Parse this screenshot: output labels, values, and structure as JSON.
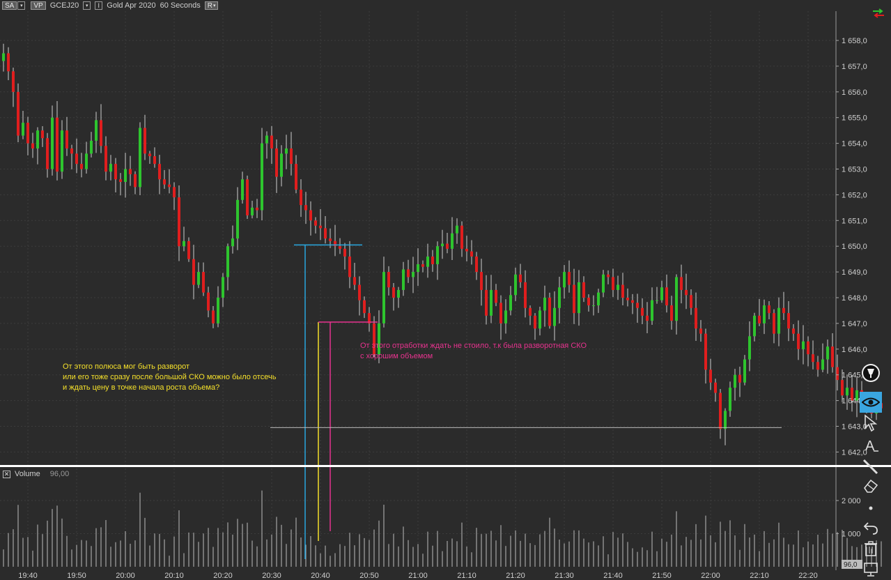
{
  "toolbar": {
    "sa_label": "SA",
    "vp_label": "VP",
    "symbol": "GCEJ20",
    "instrument": "Gold Apr 2020",
    "timeframe": "60 Seconds",
    "r_label": "R",
    "i_label": "I"
  },
  "price_axis": {
    "labels": [
      "1 658,0",
      "1 657,0",
      "1 656,0",
      "1 655,0",
      "1 654,0",
      "1 653,0",
      "1 652,0",
      "1 651,0",
      "1 650,0",
      "1 649,0",
      "1 648,0",
      "1 647,0",
      "1 646,0",
      "1 645,0",
      "1 644,0",
      "1 643,0",
      "1 642,0"
    ],
    "values": [
      1658,
      1657,
      1656,
      1655,
      1654,
      1653,
      1652,
      1651,
      1650,
      1649,
      1648,
      1647,
      1646,
      1645,
      1644,
      1643,
      1642
    ]
  },
  "time_axis": {
    "labels": [
      "19:40",
      "19:50",
      "20:00",
      "20:10",
      "20:20",
      "20:30",
      "20:40",
      "20:50",
      "21:00",
      "21:10",
      "21:20",
      "21:30",
      "21:40",
      "21:50",
      "22:00",
      "22:10",
      "22:20"
    ]
  },
  "volume_pane": {
    "title": "Volume",
    "value": "96,00",
    "axis_labels": [
      "2 000",
      "1 000"
    ],
    "axis_values": [
      2000,
      1000
    ],
    "last_value_badge": "96,0"
  },
  "annotations": {
    "yellow": [
      "От этого полюса мог быть разворот",
      "или его тоже сразу после большой СКО можно было отсечь",
      "и ждать цену в точке начала роста объема?"
    ],
    "pink": [
      "От этого отработки ждать не стоило, т.к была разворотная СКО",
      "с хорошим объемом"
    ]
  },
  "colors": {
    "background": "#2b2b2b",
    "up_candle": "#2ec52e",
    "down_candle": "#e01e1e",
    "wick": "#cfcfcf",
    "grid": "#3c3c3c",
    "annotation_blue": "#29a8e0",
    "annotation_yellow": "#f5e02a",
    "annotation_pink": "#e8338f",
    "separator": "#ffffff"
  },
  "drawing_tools": [
    {
      "name": "pen-tool-icon"
    },
    {
      "name": "eye-icon"
    },
    {
      "name": "pointer-arrow-icon"
    },
    {
      "name": "text-tool-icon",
      "glyph": "A"
    },
    {
      "name": "line-tool-icon"
    },
    {
      "name": "eraser-icon"
    },
    {
      "name": "dot-icon"
    },
    {
      "name": "undo-icon"
    },
    {
      "name": "trash-icon"
    },
    {
      "name": "monitor-icon"
    }
  ],
  "chart_data": {
    "type": "candlestick",
    "xlabel": "",
    "ylabel": "",
    "ylim": [
      1642,
      1658.5
    ],
    "volume_ylim": [
      0,
      2500
    ],
    "bar_interval_seconds": 60,
    "start_time": "19:35",
    "start_price": 1657.2,
    "closes": [
      1657.5,
      1656.8,
      1656.0,
      1654.3,
      1654.8,
      1654.0,
      1653.8,
      1654.5,
      1654.2,
      1653.0,
      1655.0,
      1652.9,
      1654.5,
      1653.8,
      1653.6,
      1653.2,
      1653.0,
      1653.6,
      1654.1,
      1654.9,
      1653.9,
      1652.9,
      1653.2,
      1652.6,
      1652.5,
      1653.0,
      1652.8,
      1652.3,
      1654.6,
      1653.6,
      1653.5,
      1653.2,
      1652.6,
      1652.4,
      1652.3,
      1651.9,
      1650.0,
      1650.2,
      1649.5,
      1648.5,
      1649.0,
      1648.2,
      1647.5,
      1647.0,
      1648.0,
      1648.8,
      1650.0,
      1650.3,
      1651.8,
      1652.6,
      1651.2,
      1651.5,
      1651.4,
      1654.0,
      1654.3,
      1653.8,
      1652.7,
      1653.6,
      1653.8,
      1653.2,
      1652.2,
      1651.6,
      1651.4,
      1651.0,
      1650.8,
      1650.7,
      1650.3,
      1650.2,
      1650.0,
      1649.9,
      1649.6,
      1648.8,
      1648.5,
      1647.9,
      1647.4,
      1647.0,
      1645.8,
      1647.0,
      1649.0,
      1648.4,
      1648.0,
      1648.3,
      1649.1,
      1648.8,
      1649.0,
      1649.3,
      1649.2,
      1649.6,
      1649.3,
      1650.0,
      1650.1,
      1649.9,
      1650.5,
      1650.8,
      1649.9,
      1649.8,
      1649.6,
      1649.0,
      1648.3,
      1647.3,
      1648.3,
      1647.8,
      1647.0,
      1647.5,
      1648.1,
      1648.9,
      1648.6,
      1647.6,
      1647.3,
      1646.8,
      1647.5,
      1648.0,
      1646.9,
      1647.6,
      1648.4,
      1649.0,
      1648.5,
      1647.4,
      1648.6,
      1648.0,
      1647.7,
      1647.7,
      1648.2,
      1648.9,
      1648.8,
      1648.3,
      1648.5,
      1648.0,
      1647.9,
      1647.8,
      1647.6,
      1647.3,
      1647.1,
      1647.9,
      1647.9,
      1648.4,
      1647.7,
      1647.1,
      1648.8,
      1648.3,
      1648.1,
      1647.6,
      1646.8,
      1646.6,
      1645.2,
      1644.7,
      1644.3,
      1642.9,
      1643.6,
      1644.5,
      1645.0,
      1644.7,
      1645.6,
      1646.5,
      1647.3,
      1647.0,
      1647.7,
      1647.4,
      1646.6,
      1647.6,
      1647.4,
      1646.8,
      1646.6,
      1646.0,
      1646.3,
      1645.8,
      1645.5,
      1645.2,
      1645.6,
      1646.1,
      1645.3,
      1644.8,
      1644.2,
      1644.5,
      1644.0,
      1644.4,
      1644.1,
      1643.8,
      1643.5,
      1643.9,
      1643.7
    ]
  }
}
